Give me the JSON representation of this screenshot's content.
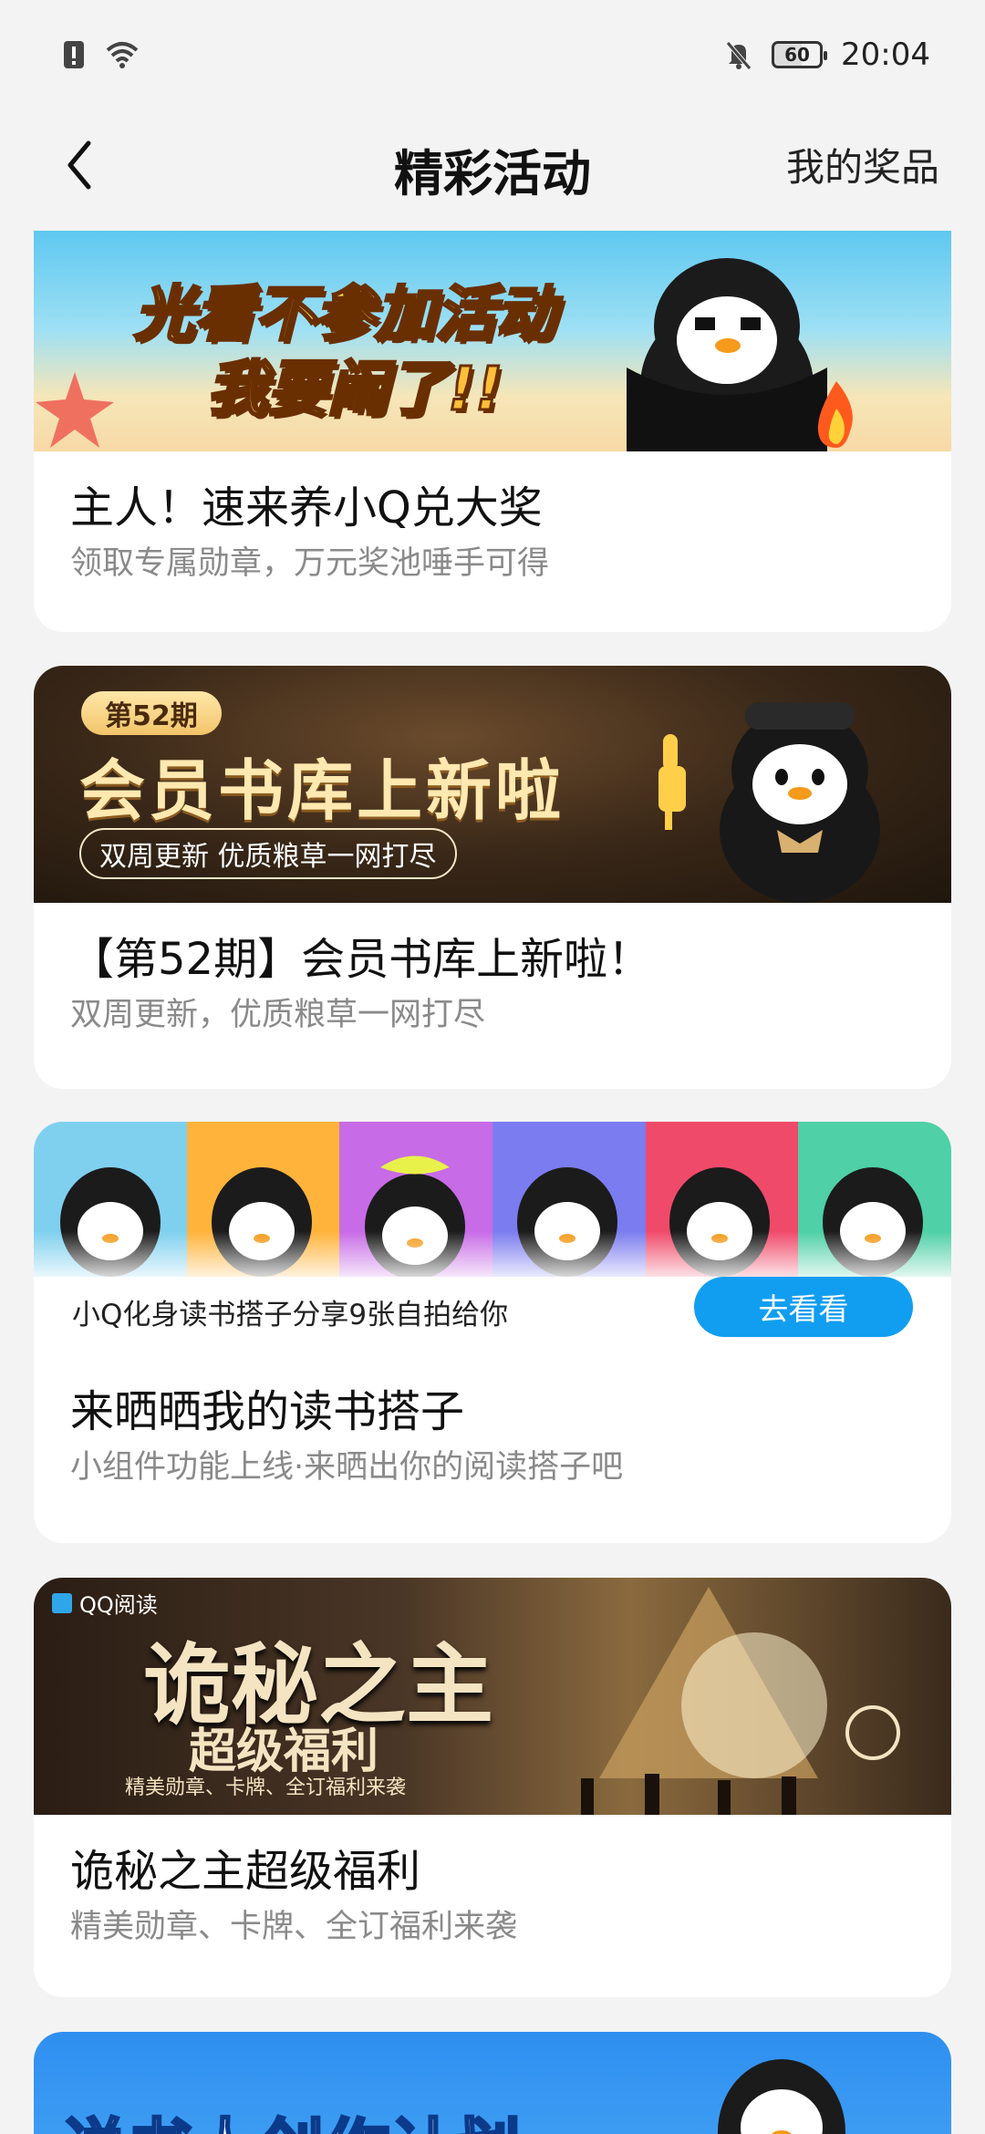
{
  "status_bar": {
    "time": "20:04",
    "battery": "60"
  },
  "nav": {
    "title": "精彩活动",
    "right_action": "我的奖品"
  },
  "cards": [
    {
      "banner_line1": "光看不参加活动",
      "banner_line2": "我要闹了!!",
      "title": "主人！速来养小Q兑大奖",
      "subtitle": "领取专属勋章，万元奖池唾手可得"
    },
    {
      "banner_badge": "第52期",
      "banner_title": "会员书库上新啦",
      "banner_pill": "双周更新  优质粮草一网打尽",
      "title": "【第52期】会员书库上新啦！",
      "subtitle": "双周更新，优质粮草一网打尽"
    },
    {
      "banner_caption": "小Q化身读书搭子分享9张自拍给你",
      "banner_button": "去看看",
      "title": "来晒晒我的读书搭子",
      "subtitle": "小组件功能上线·来晒出你的阅读搭子吧"
    },
    {
      "banner_logo": "QQ阅读",
      "banner_title": "诡秘之主",
      "banner_sub": "超级福利",
      "banner_line": "精美勋章、卡牌、全订福利来袭",
      "title": "诡秘之主超级福利",
      "subtitle": "精美勋章、卡牌、全订福利来袭"
    },
    {
      "banner_text": "说书人创作计划"
    }
  ],
  "colors": {
    "accent_blue": "#119ef0",
    "background": "#f3f3f3"
  }
}
